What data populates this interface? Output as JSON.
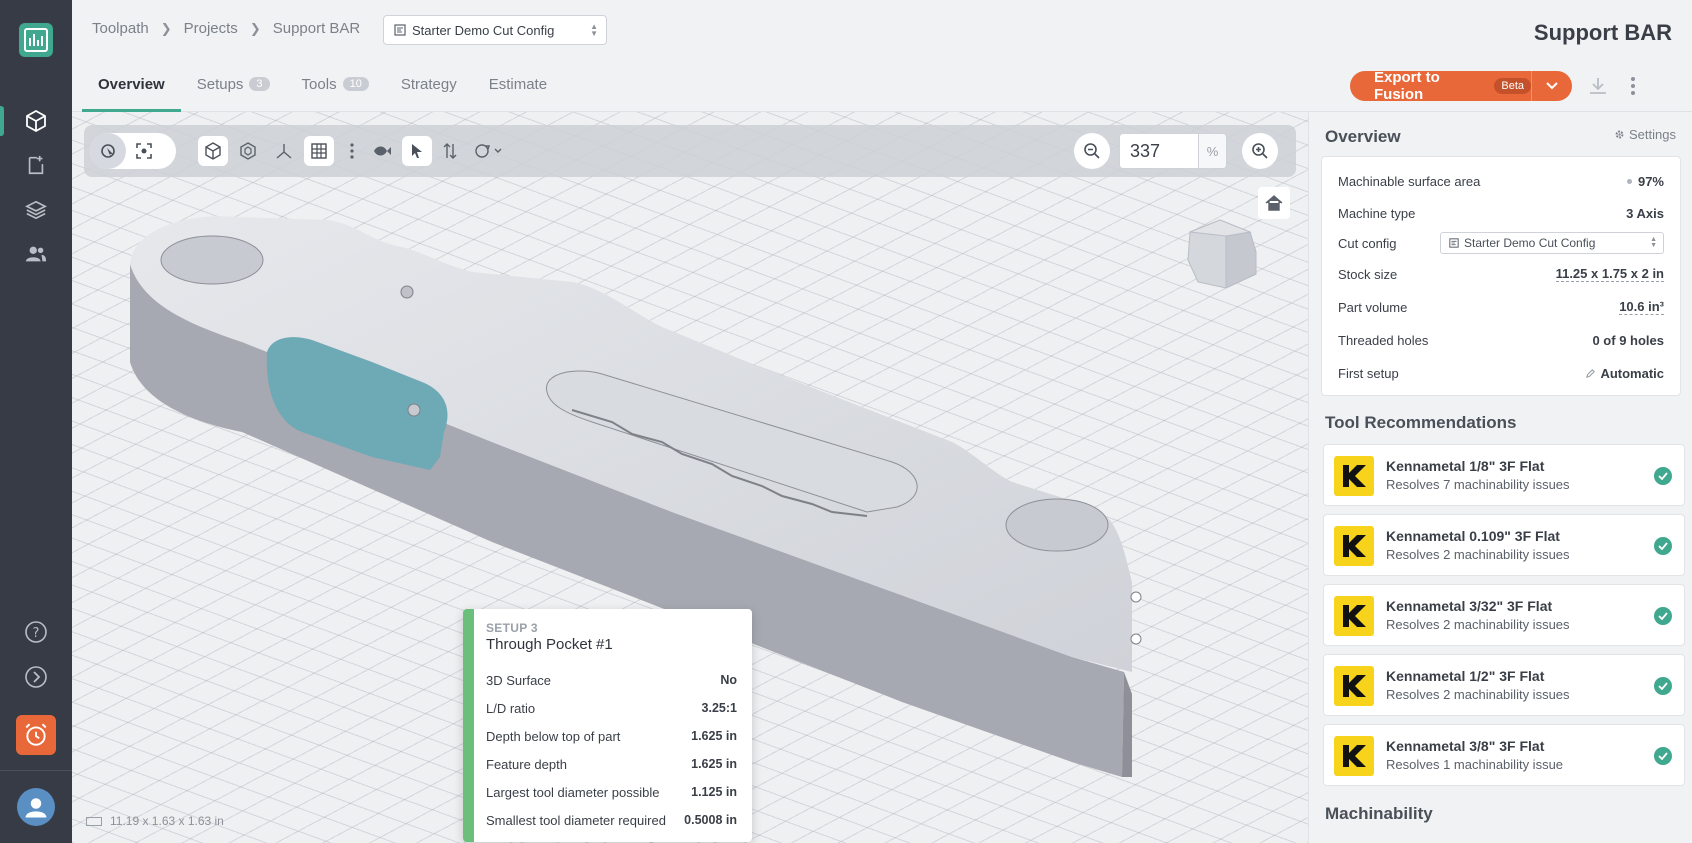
{
  "breadcrumb": [
    "Toolpath",
    "Projects",
    "Support BAR"
  ],
  "cut_config_select": "Starter Demo Cut Config",
  "page_title": "Support BAR",
  "tabs": [
    {
      "label": "Overview",
      "badge": ""
    },
    {
      "label": "Setups",
      "badge": "3"
    },
    {
      "label": "Tools",
      "badge": "10"
    },
    {
      "label": "Strategy",
      "badge": ""
    },
    {
      "label": "Estimate",
      "badge": ""
    }
  ],
  "export": {
    "label": "Export to Fusion",
    "badge": "Beta"
  },
  "viewport": {
    "zoom_value": "337",
    "zoom_unit": "%",
    "dimensions": "11.19 x 1.63 x 1.63 in"
  },
  "popup": {
    "setup": "SETUP 3",
    "title": "Through Pocket #1",
    "rows": [
      {
        "label": "3D Surface",
        "value": "No"
      },
      {
        "label": "L/D ratio",
        "value": "3.25:1"
      },
      {
        "label": "Depth below top of part",
        "value": "1.625 in"
      },
      {
        "label": "Feature depth",
        "value": "1.625 in"
      },
      {
        "label": "Largest tool diameter possible",
        "value": "1.125 in"
      },
      {
        "label": "Smallest tool diameter required",
        "value": "0.5008 in"
      }
    ]
  },
  "overview": {
    "title": "Overview",
    "settings": "Settings",
    "rows": [
      {
        "label": "Machinable surface area",
        "value": "97%"
      },
      {
        "label": "Machine type",
        "value": "3 Axis"
      },
      {
        "label": "Cut config",
        "value": "Starter Demo Cut Config"
      },
      {
        "label": "Stock size",
        "value": "11.25 x 1.75 x 2 in"
      },
      {
        "label": "Part volume",
        "value": "10.6 in³"
      },
      {
        "label": "Threaded holes",
        "value": "0 of 9 holes"
      },
      {
        "label": "First setup",
        "value": "Automatic"
      }
    ]
  },
  "tool_recommendations": {
    "title": "Tool Recommendations",
    "items": [
      {
        "name": "Kennametal 1/8\" 3F Flat",
        "sub": "Resolves 7 machinability issues"
      },
      {
        "name": "Kennametal 0.109\" 3F Flat",
        "sub": "Resolves 2 machinability issues"
      },
      {
        "name": "Kennametal 3/32\" 3F Flat",
        "sub": "Resolves 2 machinability issues"
      },
      {
        "name": "Kennametal 1/2\" 3F Flat",
        "sub": "Resolves 2 machinability issues"
      },
      {
        "name": "Kennametal 3/8\" 3F Flat",
        "sub": "Resolves 1 machinability issue"
      }
    ]
  },
  "machinability_title": "Machinability",
  "colors": {
    "accent": "#3fa88f",
    "export": "#e8683a",
    "rail": "#363b45",
    "pocket": "#6ea9b6",
    "kennametal": "#f7d31c"
  }
}
